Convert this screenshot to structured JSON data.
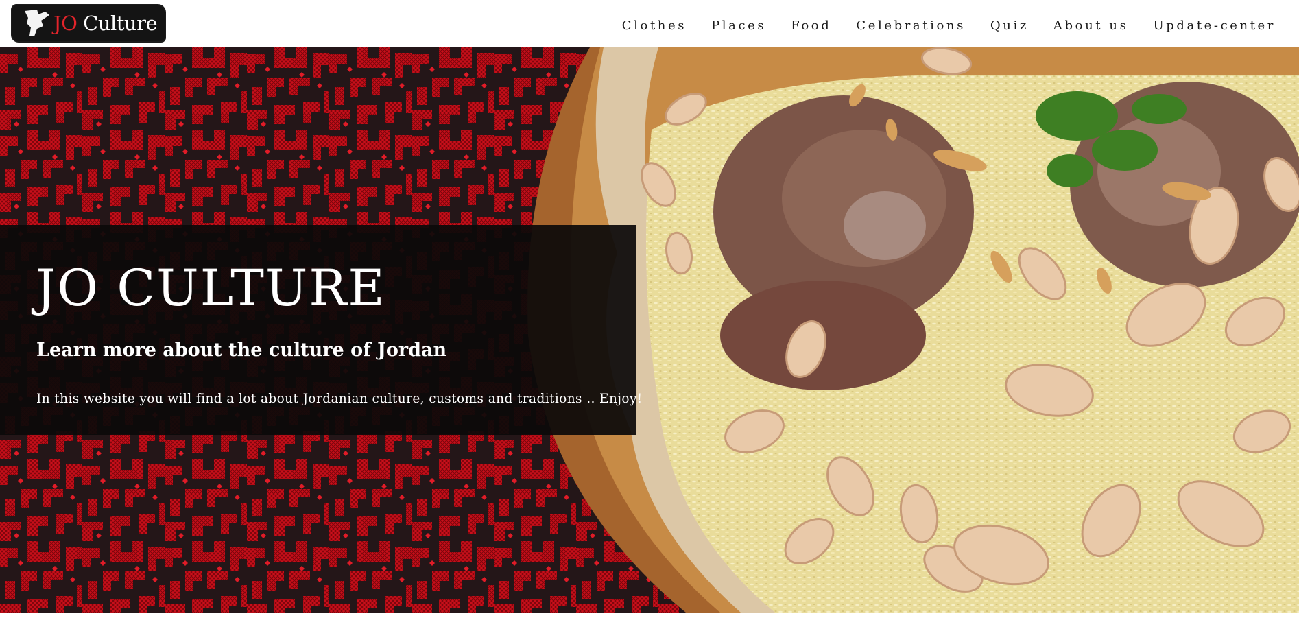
{
  "header": {
    "logo": {
      "jo": "JO",
      "culture": " Culture"
    },
    "nav": [
      {
        "label": "Clothes"
      },
      {
        "label": "Places"
      },
      {
        "label": "Food"
      },
      {
        "label": "Celebrations"
      },
      {
        "label": "Quiz"
      },
      {
        "label": "About us"
      },
      {
        "label": "Update-center"
      }
    ]
  },
  "hero": {
    "title": "JO CULTURE",
    "subtitle": "Learn more about the culture of Jordan",
    "text": "In this website you will find a lot about Jordanian culture, customs and traditions .. Enjoy!",
    "background_left": "red-black-embroidery-pattern",
    "background_right": "mansaf-dish-image"
  },
  "colors": {
    "accent_red": "#e3242b",
    "embroidery_red": "#d3111c",
    "panel_bg": "#0c0a0a",
    "header_bg": "#ffffff"
  }
}
